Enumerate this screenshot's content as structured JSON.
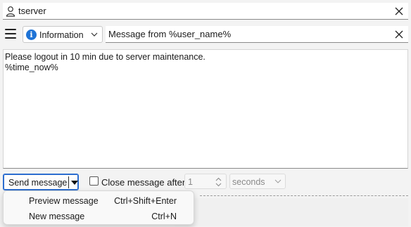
{
  "recipient": {
    "value": "tserver",
    "user_icon": "user-icon",
    "clear_icon": "close-icon"
  },
  "message_options": {
    "menu_icon": "hamburger-menu-icon",
    "type": {
      "selected": "Information",
      "icon": "info-icon",
      "icon_color": "#1e73d6"
    },
    "subject": {
      "value": "Message from %user_name%",
      "clear_icon": "close-icon"
    }
  },
  "body": {
    "lines": [
      "Please logout in 10 min due to server maintenance.",
      "",
      "%time_now%"
    ]
  },
  "controls": {
    "send_button_label": "Send message",
    "send_dropdown_icon": "caret-down-icon",
    "accent_color": "#2c6dcf",
    "close_after": {
      "label": "Close message after",
      "checked": false,
      "value": "1",
      "unit": "seconds"
    }
  },
  "send_menu": {
    "items": [
      {
        "label": "Preview message",
        "shortcut": "Ctrl+Shift+Enter"
      },
      {
        "label": "New message",
        "shortcut": "Ctrl+N"
      }
    ]
  }
}
